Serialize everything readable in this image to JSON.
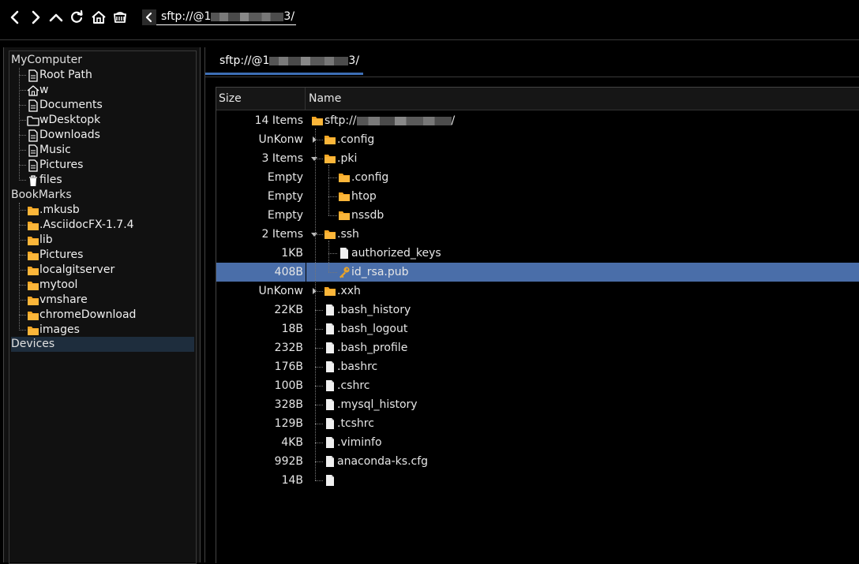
{
  "toolbar": {
    "icons": [
      "back-icon",
      "forward-icon",
      "up-icon",
      "refresh-icon",
      "home-icon",
      "network-icon"
    ],
    "address_prefix": "sftp://@1",
    "address_suffix": "3/"
  },
  "sidebar": {
    "mycomputer_label": "MyComputer",
    "mycomputer_items": [
      {
        "label": "Root Path",
        "icon": "document-icon"
      },
      {
        "label": "w",
        "icon": "home-icon"
      },
      {
        "label": "Documents",
        "icon": "document-icon"
      },
      {
        "label": "wDesktopk",
        "icon": "folder-outline-icon"
      },
      {
        "label": "Downloads",
        "icon": "document-icon"
      },
      {
        "label": "Music",
        "icon": "document-icon"
      },
      {
        "label": "Pictures",
        "icon": "document-icon"
      },
      {
        "label": "files",
        "icon": "trash-icon"
      }
    ],
    "bookmarks_label": "BookMarks",
    "bookmark_items": [
      {
        "label": ".mkusb"
      },
      {
        "label": ".AsciidocFX-1.7.4"
      },
      {
        "label": "lib"
      },
      {
        "label": "Pictures"
      },
      {
        "label": "localgitserver"
      },
      {
        "label": "mytool"
      },
      {
        "label": "vmshare"
      },
      {
        "label": "chromeDownload"
      },
      {
        "label": "images"
      }
    ],
    "devices_label": "Devices"
  },
  "tab": {
    "prefix": "sftp://@1",
    "suffix": "3/"
  },
  "table": {
    "columns": {
      "size": "Size",
      "name": "Name"
    },
    "root_prefix": "sftp://",
    "root_suffix": "/",
    "rows": [
      {
        "size": "14 Items",
        "name": "",
        "type": "folder",
        "depth": 0,
        "root": true
      },
      {
        "size": "UnKonw",
        "name": ".config",
        "type": "folder",
        "depth": 1,
        "expander": "right"
      },
      {
        "size": "3 Items",
        "name": ".pki",
        "type": "folder",
        "depth": 1,
        "expander": "down"
      },
      {
        "size": "Empty",
        "name": ".config",
        "type": "folder",
        "depth": 2
      },
      {
        "size": "Empty",
        "name": "htop",
        "type": "folder",
        "depth": 2
      },
      {
        "size": "Empty",
        "name": "nssdb",
        "type": "folder",
        "depth": 2
      },
      {
        "size": "2 Items",
        "name": ".ssh",
        "type": "folder",
        "depth": 1,
        "expander": "down"
      },
      {
        "size": "1KB",
        "name": "authorized_keys",
        "type": "file",
        "depth": 2
      },
      {
        "size": "408B",
        "name": "id_rsa.pub",
        "type": "key",
        "depth": 2,
        "selected": true
      },
      {
        "size": "UnKonw",
        "name": ".xxh",
        "type": "folder",
        "depth": 1,
        "expander": "right"
      },
      {
        "size": "22KB",
        "name": ".bash_history",
        "type": "file",
        "depth": 1
      },
      {
        "size": "18B",
        "name": ".bash_logout",
        "type": "file",
        "depth": 1
      },
      {
        "size": "232B",
        "name": ".bash_profile",
        "type": "file",
        "depth": 1
      },
      {
        "size": "176B",
        "name": ".bashrc",
        "type": "file",
        "depth": 1
      },
      {
        "size": "100B",
        "name": ".cshrc",
        "type": "file",
        "depth": 1
      },
      {
        "size": "328B",
        "name": ".mysql_history",
        "type": "file",
        "depth": 1
      },
      {
        "size": "129B",
        "name": ".tcshrc",
        "type": "file",
        "depth": 1
      },
      {
        "size": "4KB",
        "name": ".viminfo",
        "type": "file",
        "depth": 1
      },
      {
        "size": "992B",
        "name": "anaconda-ks.cfg",
        "type": "file",
        "depth": 1
      },
      {
        "size": "14B",
        "name": "",
        "type": "file",
        "depth": 1
      }
    ]
  },
  "colors": {
    "selection": "#4a6ea9",
    "folder": "#f5a623",
    "tab_underline": "#3d6fb6",
    "devices_highlight": "#1e2d3d"
  }
}
